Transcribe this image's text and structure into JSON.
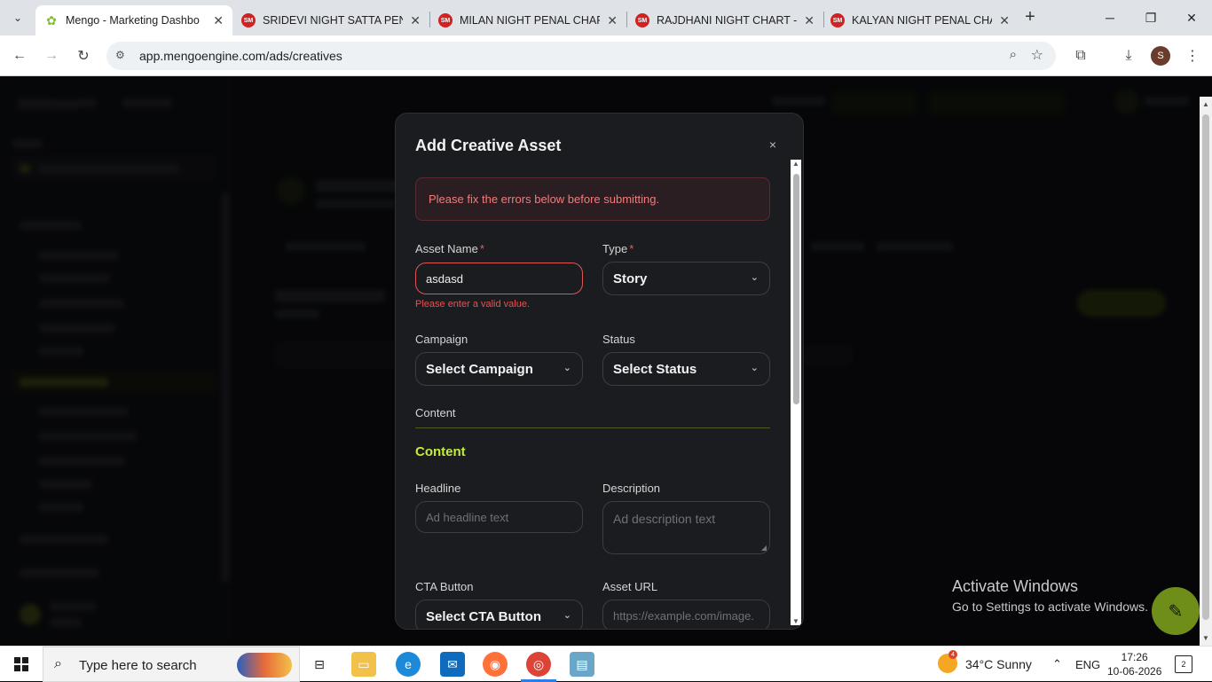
{
  "browser": {
    "tabs": [
      {
        "title": "Mengo - Marketing Dashbo",
        "favicon": "mengo-leaf-icon",
        "active": true
      },
      {
        "title": "SRIDEVI NIGHT SATTA PENA",
        "favicon": "SM",
        "active": false
      },
      {
        "title": "MILAN NIGHT PENAL CHAR",
        "favicon": "SM",
        "active": false
      },
      {
        "title": "RAJDHANI NIGHT CHART - S",
        "favicon": "SM",
        "active": false
      },
      {
        "title": "KALYAN NIGHT PENAL CHAR",
        "favicon": "SM",
        "active": false
      }
    ],
    "url": "app.mengoengine.com/ads/creatives",
    "profile_initial": "S"
  },
  "modal": {
    "title": "Add Creative Asset",
    "close_label": "×",
    "error_banner": "Please fix the errors below before submitting.",
    "fields": {
      "asset_name": {
        "label": "Asset Name",
        "required_mark": "*",
        "value": "asdasd",
        "error": "Please enter a valid value."
      },
      "type": {
        "label": "Type",
        "required_mark": "*",
        "value": "Story"
      },
      "campaign": {
        "label": "Campaign",
        "value": "Select Campaign"
      },
      "status": {
        "label": "Status",
        "value": "Select Status"
      },
      "headline": {
        "label": "Headline",
        "placeholder": "Ad headline text"
      },
      "description": {
        "label": "Description",
        "placeholder": "Ad description text"
      },
      "cta_button": {
        "label": "CTA Button",
        "value": "Select CTA Button"
      },
      "asset_url": {
        "label": "Asset URL",
        "placeholder": "https://example.com/image."
      }
    },
    "section_label": "Content",
    "section_heading": "Content"
  },
  "watermark": {
    "line1": "Activate Windows",
    "line2": "Go to Settings to activate Windows."
  },
  "taskbar": {
    "search_placeholder": "Type here to search",
    "weather": "34°C  Sunny",
    "weather_badge": "4",
    "language": "ENG",
    "time": "17:26",
    "date": "10-06-2026"
  },
  "colors": {
    "accent": "#c6ec3a",
    "error": "#e25555",
    "modal_bg": "#1a1c20"
  }
}
